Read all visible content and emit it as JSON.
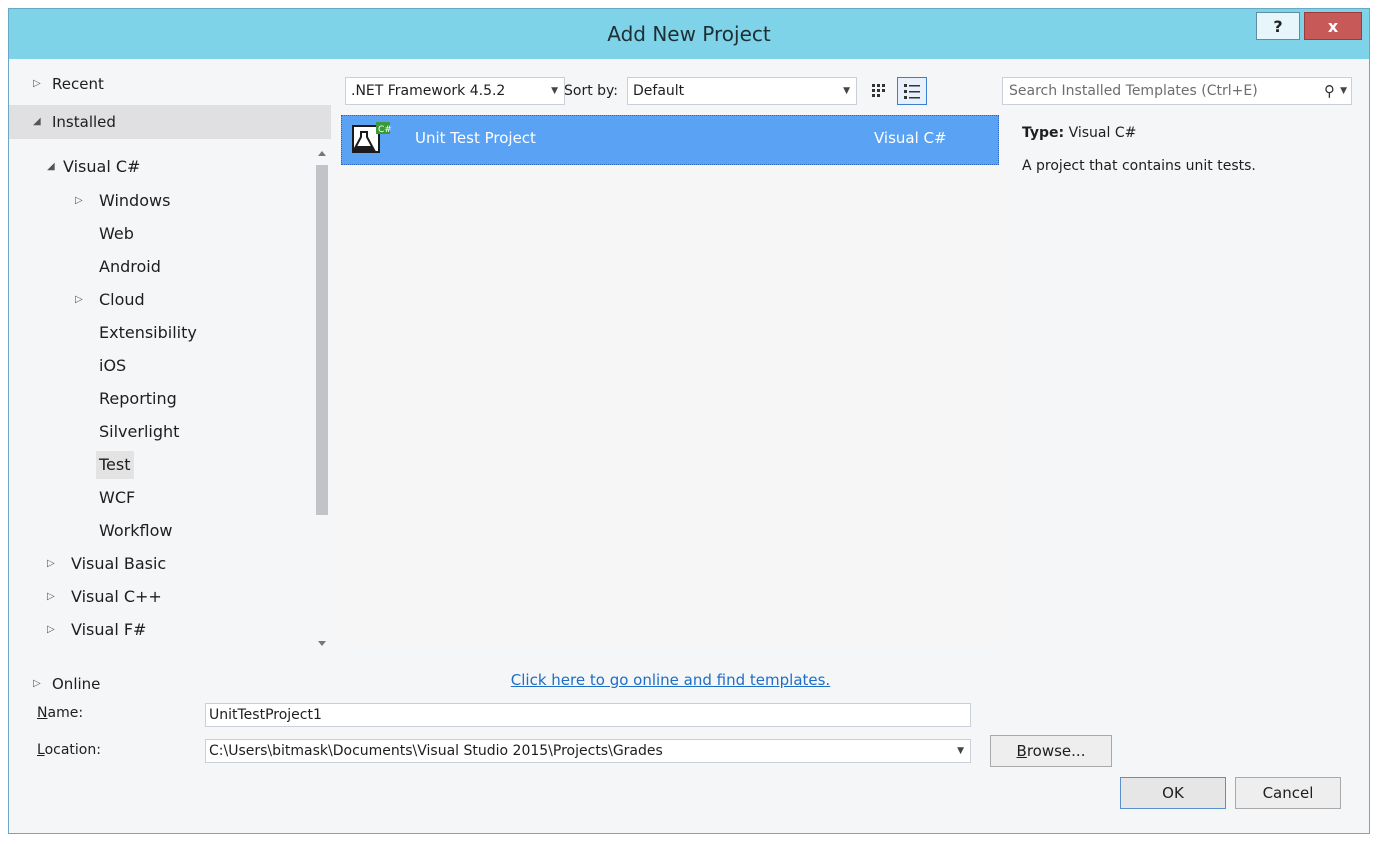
{
  "window": {
    "title": "Add New Project",
    "help": "?",
    "close": "x"
  },
  "left": {
    "recent": "Recent",
    "installed": "Installed",
    "online": "Online",
    "tree": [
      {
        "label": "Visual C#"
      },
      {
        "label": "Windows"
      },
      {
        "label": "Web"
      },
      {
        "label": "Android"
      },
      {
        "label": "Cloud"
      },
      {
        "label": "Extensibility"
      },
      {
        "label": "iOS"
      },
      {
        "label": "Reporting"
      },
      {
        "label": "Silverlight"
      },
      {
        "label": "Test"
      },
      {
        "label": "WCF"
      },
      {
        "label": "Workflow"
      },
      {
        "label": "Visual Basic"
      },
      {
        "label": "Visual C++"
      },
      {
        "label": "Visual F#"
      }
    ],
    "selected": "Test"
  },
  "toolbar": {
    "framework": ".NET Framework 4.5.2",
    "sort_label": "Sort by:",
    "sort_value": "Default"
  },
  "templates": [
    {
      "name": "Unit Test Project",
      "language": "Visual C#",
      "icon": "unit-test-icon"
    }
  ],
  "online_link": "Click here to go online and find templates.",
  "search": {
    "placeholder": "Search Installed Templates (Ctrl+E)"
  },
  "description": {
    "type_label": "Type:",
    "type_value": "Visual C#",
    "text": "A project that contains unit tests."
  },
  "form": {
    "name_label": "Name:",
    "name_value": "UnitTestProject1",
    "location_label": "Location:",
    "location_value": "C:\\Users\\bitmask\\Documents\\Visual Studio 2015\\Projects\\Grades",
    "browse": "Browse...",
    "ok": "OK",
    "cancel": "Cancel"
  },
  "colors": {
    "titlebar": "#7fd3e8",
    "selection": "#59a2f4",
    "close": "#c75a58",
    "link": "#1e6ec7"
  }
}
